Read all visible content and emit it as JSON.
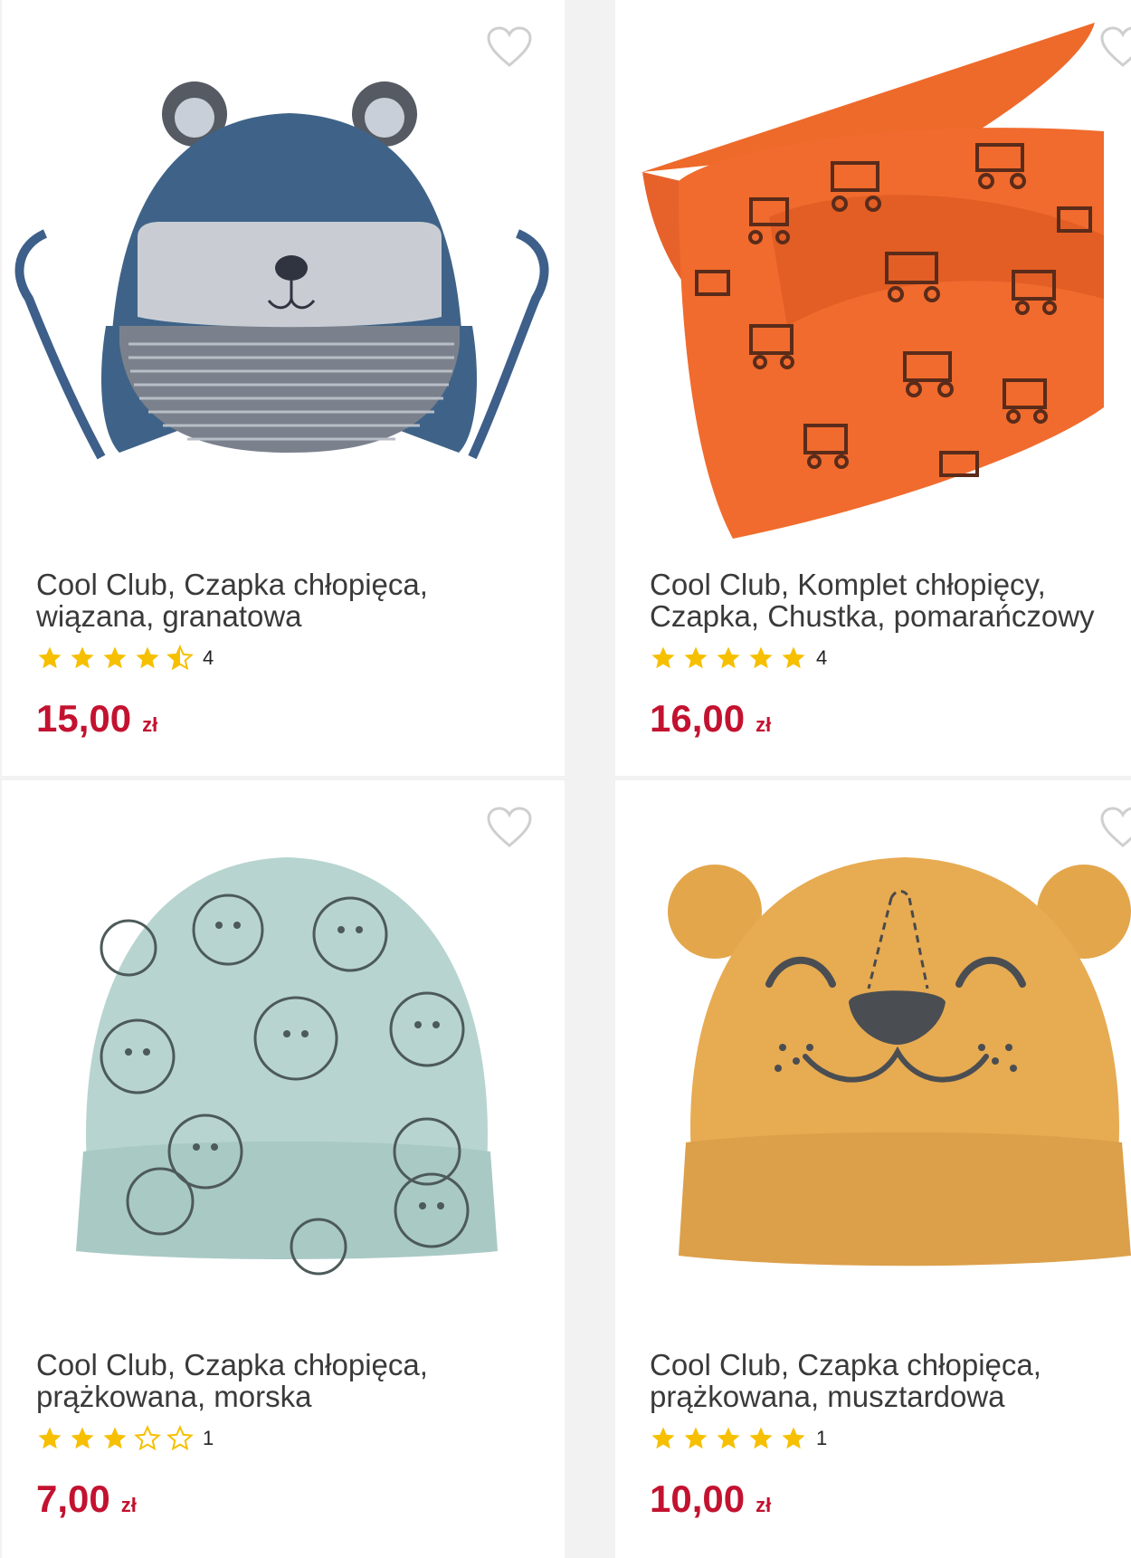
{
  "colors": {
    "price": "#c3122f",
    "star": "#f6c000",
    "title": "#3a3a3a",
    "background": "#f2f2f2"
  },
  "products": [
    {
      "title_line1": "Cool Club, Czapka chłopięca,",
      "title_line2": "wiązana, granatowa",
      "rating": 4.5,
      "reviews": "4",
      "price": "15,00",
      "currency": "zł",
      "favorite_icon": "heart-outline-icon"
    },
    {
      "title_line1": "Cool Club, Komplet chłopięcy,",
      "title_line2": "Czapka, Chustka, pomarańczowy",
      "rating": 5,
      "reviews": "4",
      "price": "16,00",
      "currency": "zł",
      "favorite_icon": "heart-outline-icon"
    },
    {
      "title_line1": "Cool Club, Czapka chłopięca,",
      "title_line2": "prążkowana, morska",
      "rating": 3,
      "reviews": "1",
      "price": "7,00",
      "currency": "zł",
      "favorite_icon": "heart-outline-icon"
    },
    {
      "title_line1": "Cool Club, Czapka chłopięca,",
      "title_line2": "prążkowana, musztardowa",
      "rating": 5,
      "reviews": "1",
      "price": "10,00",
      "currency": "zł",
      "favorite_icon": "heart-outline-icon"
    }
  ]
}
